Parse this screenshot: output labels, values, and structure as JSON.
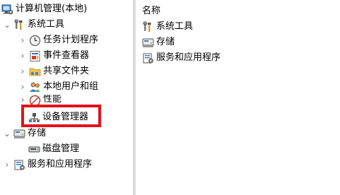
{
  "tree": {
    "root": {
      "label": "计算机管理(本地)"
    },
    "system_tools": {
      "label": "系统工具",
      "children": [
        {
          "label": "任务计划程序"
        },
        {
          "label": "事件查看器"
        },
        {
          "label": "共享文件夹"
        },
        {
          "label": "本地用户和组"
        },
        {
          "label": "性能"
        },
        {
          "label": "设备管理器"
        }
      ]
    },
    "storage": {
      "label": "存储",
      "children": [
        {
          "label": "磁盘管理"
        }
      ]
    },
    "services": {
      "label": "服务和应用程序"
    }
  },
  "list": {
    "column_header": "名称",
    "items": [
      {
        "label": "系统工具",
        "icon": "tools-icon"
      },
      {
        "label": "存储",
        "icon": "storage-icon"
      },
      {
        "label": "服务和应用程序",
        "icon": "services-icon"
      }
    ]
  },
  "highlight": {
    "color": "#e3111a",
    "target": "设备管理器"
  }
}
